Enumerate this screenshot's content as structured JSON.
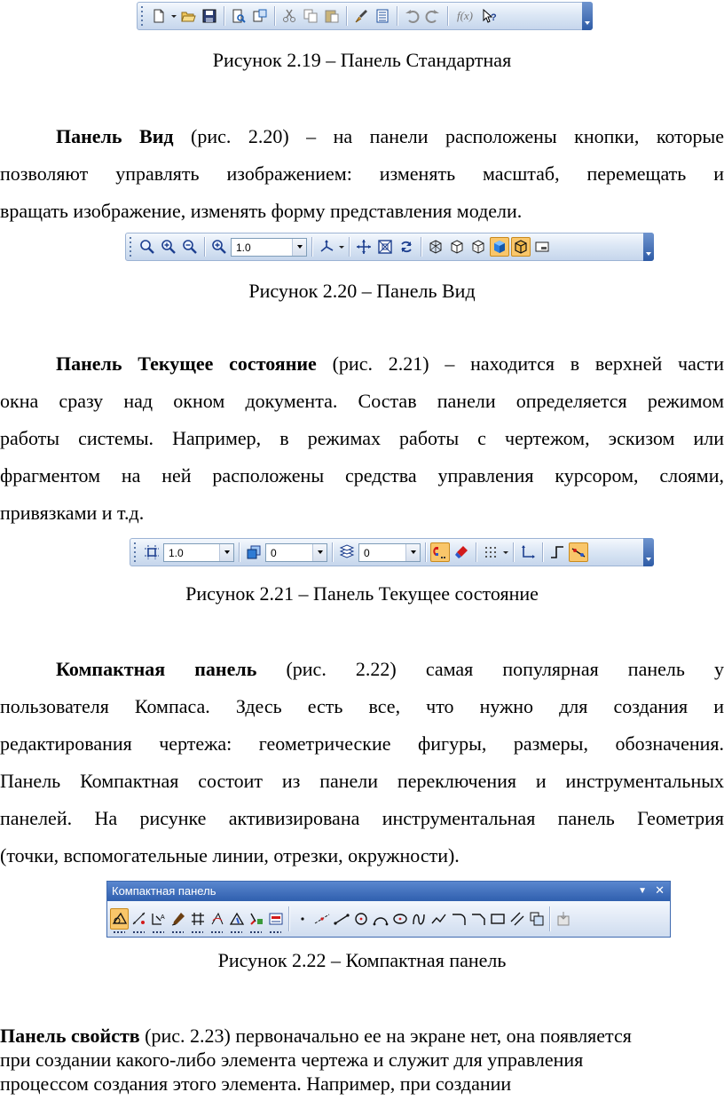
{
  "captions": {
    "fig19": "Рисунок 2.19 – Панель Стандартная",
    "fig20": "Рисунок 2.20 – Панель Вид",
    "fig21": "Рисунок 2.21 – Панель Текущее состояние",
    "fig22": "Рисунок 2.22 – Компактная панель"
  },
  "toolbar_view": {
    "scale_value": "1.0"
  },
  "toolbar_state": {
    "step_value": "1.0",
    "layer_value": "0",
    "style_value": "0"
  },
  "toolbar_standard": {
    "fx_label": "f(x)"
  },
  "compact_panel": {
    "title": "Компактная панель",
    "menu_glyph": "▼",
    "close_glyph": "✕"
  },
  "para_view": {
    "bold": "Панель Вид",
    "line1": "(рис. 2.20) – на панели расположены кнопки, которые",
    "line2": "позволяют управлять изображением: изменять масштаб, перемещать и",
    "line3": "вращать изображение, изменять форму представления модели."
  },
  "para_state": {
    "bold": "Панель Текущее состояние",
    "line1": "(рис. 2.21) – находится в верхней части",
    "line2": "окна сразу над окном документа. Состав панели определяется режимом",
    "line3": "работы системы. Например, в режимах работы с чертежом, эскизом или",
    "line4": "фрагментом на ней расположены средства управления курсором, слоями,",
    "line5": "привязками и т.д."
  },
  "para_compact": {
    "bold": "Компактная панель",
    "line1": "(рис. 2.22) самая популярная панель у",
    "line2": "пользователя Компаса. Здесь есть все, что нужно для создания и",
    "line3": "редактирования чертежа: геометрические фигуры, размеры, обозначения.",
    "line4": "Панель Компактная состоит из панели переключения и инструментальных",
    "line5": "панелей. На рисунке активизирована инструментальная панель Геометрия",
    "line6": "(точки, вспомогательные линии, отрезки, окружности)."
  },
  "para_props": {
    "bold": "Панель свойств",
    "line1": "(рис. 2.23) первоначально ее на экране нет, она появляется",
    "line2": "при создании какого-либо элемента чертежа и служит для управления",
    "line3": "процессом создания этого элемента. Например, при создании"
  }
}
